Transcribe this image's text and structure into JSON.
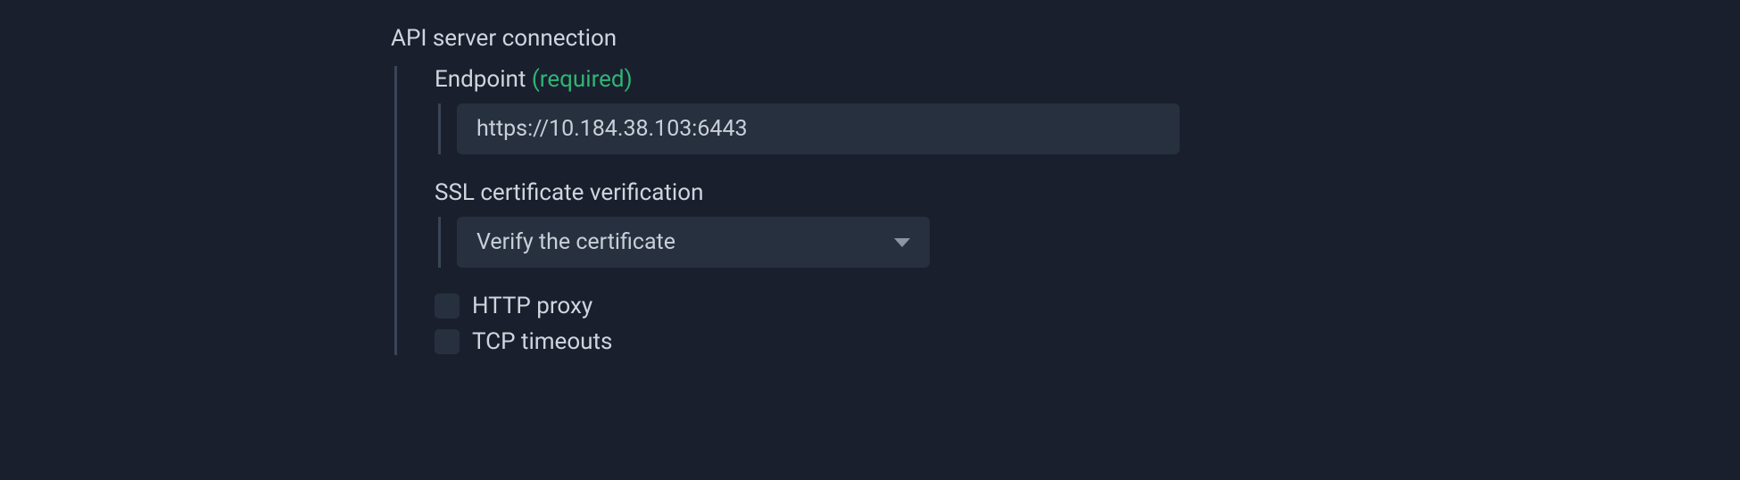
{
  "section": {
    "title": "API server connection",
    "endpoint": {
      "label": "Endpoint",
      "required_tag": "(required)",
      "value": "https://10.184.38.103:6443"
    },
    "ssl": {
      "label": "SSL certificate verification",
      "selected": "Verify the certificate"
    },
    "http_proxy": {
      "label": "HTTP proxy"
    },
    "tcp_timeouts": {
      "label": "TCP timeouts"
    }
  }
}
